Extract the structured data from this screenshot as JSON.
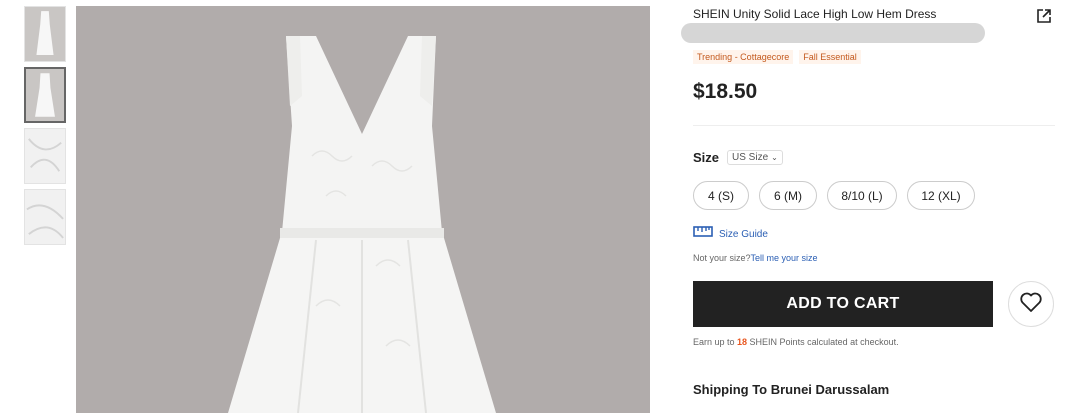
{
  "product": {
    "title": "SHEIN Unity Solid Lace High Low Hem Dress",
    "tags": [
      "Trending - Cottagecore",
      "Fall Essential"
    ],
    "price": "$18.50"
  },
  "size": {
    "label": "Size",
    "system": "US Size",
    "options": [
      "4 (S)",
      "6 (M)",
      "8/10 (L)",
      "12 (XL)"
    ],
    "guide_label": "Size Guide",
    "not_your_size": "Not your size?",
    "tell_me": "Tell me your size"
  },
  "cart": {
    "add_label": "ADD TO CART",
    "points_prefix": "Earn up to ",
    "points_value": "18",
    "points_suffix": " SHEIN Points calculated at checkout."
  },
  "shipping": {
    "title": "Shipping To Brunei Darussalam"
  },
  "icons": {
    "share": "external-link-icon",
    "ruler": "ruler-icon",
    "wishlist": "heart-icon",
    "dropdown": "chevron-down-icon"
  },
  "colors": {
    "accent": "#e8551e",
    "link": "#2b5fb4",
    "tag_text": "#c45a1e",
    "button": "#222222"
  }
}
